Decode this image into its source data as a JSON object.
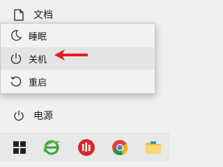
{
  "start_menu": {
    "documents_label": "文档",
    "power_label": "电源"
  },
  "power_menu": {
    "items": [
      {
        "label": "睡眠",
        "icon": "moon-icon"
      },
      {
        "label": "关机",
        "icon": "power-icon"
      },
      {
        "label": "重启",
        "icon": "restart-icon"
      }
    ],
    "highlighted": "关机",
    "annotation_arrow_color": "#e02020"
  },
  "taskbar": {
    "apps": [
      "windows-start-icon",
      "internet-explorer-icon",
      "red-app-icon",
      "chrome-icon",
      "file-explorer-icon"
    ]
  },
  "colors": {
    "background": "#f0f0f0",
    "popup_background": "#f2f2f2",
    "highlight": "#e4e4e4",
    "taskbar": "#e8e8e8",
    "windows_blue": "#0a68d8"
  }
}
